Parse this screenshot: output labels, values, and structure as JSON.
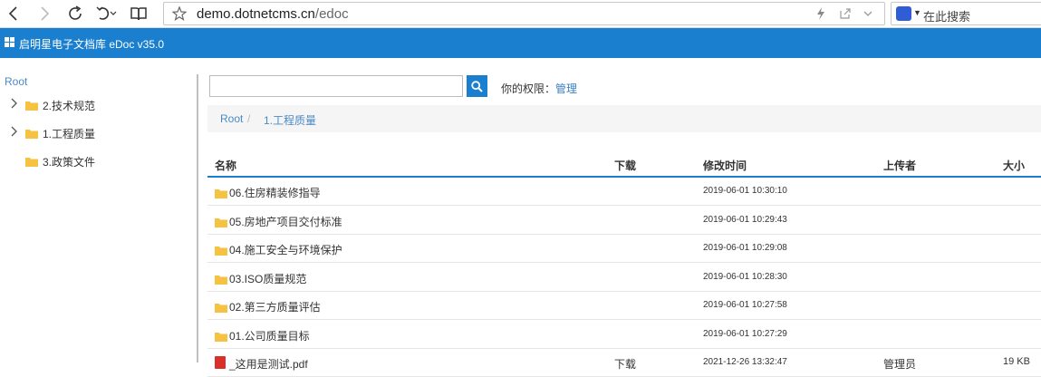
{
  "browser": {
    "url_host": "demo.dotnetcms.cn",
    "url_path": "/edoc",
    "search_placeholder": "在此搜索"
  },
  "app": {
    "title": "启明星电子文档库 eDoc v35.0"
  },
  "sidebar": {
    "root": "Root",
    "items": [
      {
        "label": "2.技术规范",
        "expandable": true
      },
      {
        "label": "1.工程质量",
        "expandable": true
      },
      {
        "label": "3.政策文件",
        "expandable": false
      }
    ]
  },
  "main": {
    "search_placeholder": "",
    "permission_label": "你的权限：",
    "permission_value": "管理",
    "breadcrumb": {
      "root": "Root",
      "separator": "/",
      "current": "1.工程质量"
    },
    "columns": {
      "name": "名称",
      "download": "下载",
      "modified": "修改时间",
      "uploader": "上传者",
      "size": "大小"
    },
    "rows": [
      {
        "type": "folder",
        "name": "06.住房精装修指导",
        "download": "",
        "modified": "2019-06-01 10:30:10",
        "uploader": "",
        "size": ""
      },
      {
        "type": "folder",
        "name": "05.房地产项目交付标准",
        "download": "",
        "modified": "2019-06-01 10:29:43",
        "uploader": "",
        "size": ""
      },
      {
        "type": "folder",
        "name": "04.施工安全与环境保护",
        "download": "",
        "modified": "2019-06-01 10:29:08",
        "uploader": "",
        "size": ""
      },
      {
        "type": "folder",
        "name": "03.ISO质量规范",
        "download": "",
        "modified": "2019-06-01 10:28:30",
        "uploader": "",
        "size": ""
      },
      {
        "type": "folder",
        "name": "02.第三方质量评估",
        "download": "",
        "modified": "2019-06-01 10:27:58",
        "uploader": "",
        "size": ""
      },
      {
        "type": "folder",
        "name": "01.公司质量目标",
        "download": "",
        "modified": "2019-06-01 10:27:29",
        "uploader": "",
        "size": ""
      },
      {
        "type": "file",
        "name": "_这用是测试.pdf",
        "download": "下载",
        "modified": "2021-12-26 13:32:47",
        "uploader": "管理员",
        "size": "19 KB"
      }
    ]
  },
  "colors": {
    "accent": "#1a7fce",
    "link": "#4a8ac4",
    "folder": "#f5c242"
  }
}
